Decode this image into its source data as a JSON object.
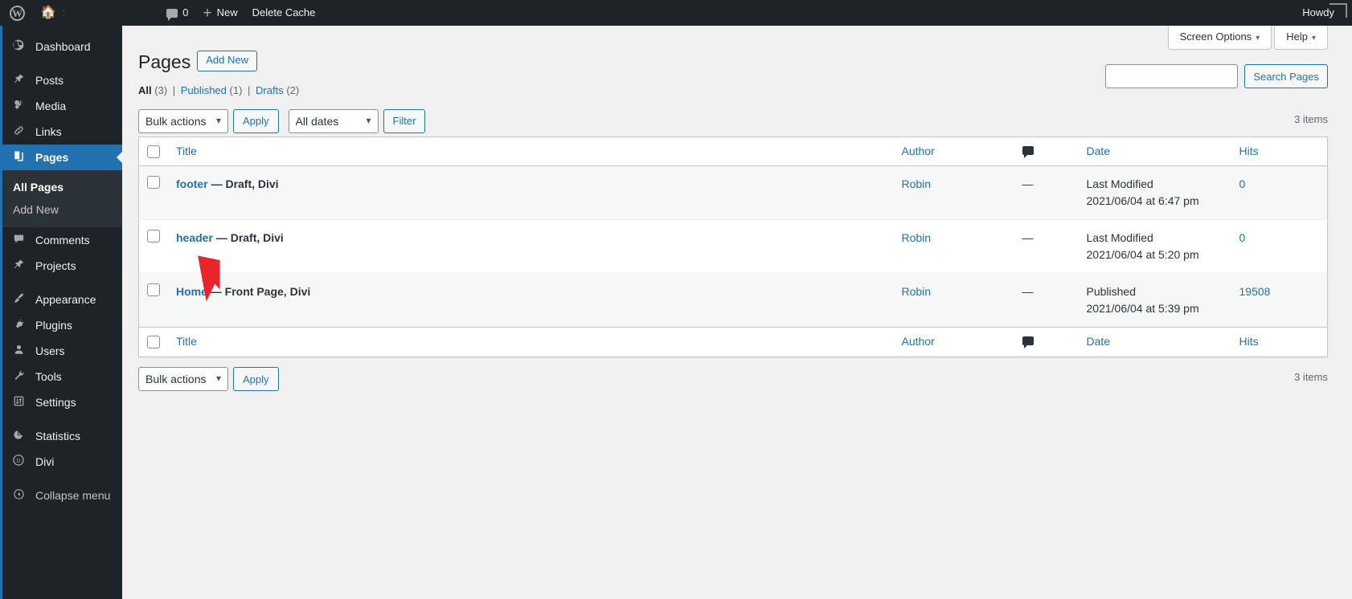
{
  "adminbar": {
    "wp_logo": "wordpress-logo",
    "site_home_icon": "home-icon",
    "site_separator": ":",
    "comments_icon": "comment-bubble-icon",
    "comments_count": "0",
    "new_plus_icon": "plus-icon",
    "new_label": "New",
    "delete_cache_label": "Delete Cache",
    "howdy_label": "Howdy"
  },
  "sidebar": {
    "items": [
      {
        "label": "Dashboard",
        "icon": "dashboard-icon",
        "glyph": "◔",
        "current": false
      },
      {
        "label": "Posts",
        "icon": "pin-icon",
        "glyph": "✒",
        "current": false
      },
      {
        "label": "Media",
        "icon": "media-icon",
        "glyph": "♪",
        "current": false
      },
      {
        "label": "Links",
        "icon": "link-icon",
        "glyph": "⚭",
        "current": false
      },
      {
        "label": "Pages",
        "icon": "page-icon",
        "glyph": "❐",
        "current": true
      },
      {
        "label": "Comments",
        "icon": "comment-icon",
        "glyph": "▬",
        "current": false
      },
      {
        "label": "Projects",
        "icon": "pin-icon",
        "glyph": "✒",
        "current": false
      },
      {
        "label": "Appearance",
        "icon": "paintbrush-icon",
        "glyph": "✐",
        "current": false
      },
      {
        "label": "Plugins",
        "icon": "plug-icon",
        "glyph": "⚡",
        "current": false
      },
      {
        "label": "Users",
        "icon": "user-icon",
        "glyph": "●",
        "current": false
      },
      {
        "label": "Tools",
        "icon": "wrench-icon",
        "glyph": "⚒",
        "current": false
      },
      {
        "label": "Settings",
        "icon": "sliders-icon",
        "glyph": "↕",
        "current": false
      },
      {
        "label": "Statistics",
        "icon": "pie-chart-icon",
        "glyph": "◔",
        "current": false
      },
      {
        "label": "Divi",
        "icon": "divi-icon",
        "glyph": "D",
        "current": false
      }
    ],
    "submenu": {
      "all_pages": "All Pages",
      "add_new": "Add New"
    },
    "collapse": {
      "label": "Collapse menu",
      "icon": "collapse-arrow-icon",
      "glyph": "◀"
    }
  },
  "screen_meta": {
    "screen_options": "Screen Options",
    "help": "Help",
    "caret": "▾"
  },
  "page": {
    "title": "Pages",
    "add_new_button": "Add New",
    "views": [
      {
        "label": "All",
        "count": "(3)",
        "current": true
      },
      {
        "label": "Published",
        "count": "(1)",
        "current": false
      },
      {
        "label": "Drafts",
        "count": "(2)",
        "current": false
      }
    ],
    "view_separator": "|"
  },
  "search": {
    "value": "",
    "placeholder": "",
    "button_label": "Search Pages"
  },
  "tablenav_top": {
    "bulk_actions_selected": "Bulk actions",
    "apply_label": "Apply",
    "dates_selected": "All dates",
    "filter_label": "Filter",
    "displaying_num": "3 items"
  },
  "tablenav_bottom": {
    "bulk_actions_selected": "Bulk actions",
    "apply_label": "Apply",
    "displaying_num": "3 items"
  },
  "table": {
    "columns": {
      "cb": "select-all-checkbox",
      "title": "Title",
      "author": "Author",
      "comments": "comment-bubble-icon",
      "date": "Date",
      "hits": "Hits"
    },
    "rows": [
      {
        "title": "footer",
        "state": "— Draft, Divi",
        "author": "Robin",
        "comments": "—",
        "date_status": "Last Modified",
        "date_value": "2021/06/04 at 6:47 pm",
        "hits": "0"
      },
      {
        "title": "header",
        "state": "— Draft, Divi",
        "author": "Robin",
        "comments": "—",
        "date_status": "Last Modified",
        "date_value": "2021/06/04 at 5:20 pm",
        "hits": "0"
      },
      {
        "title": "Home",
        "state": "— Front Page, Divi",
        "author": "Robin",
        "comments": "—",
        "date_status": "Published",
        "date_value": "2021/06/04 at 5:39 pm",
        "hits": "19508"
      }
    ]
  },
  "colors": {
    "admin_bar_bg": "#1d2327",
    "sidebar_bg": "#1d2327",
    "submenu_bg": "#2c3338",
    "accent_blue": "#2271b1",
    "link_blue": "#2271b1",
    "page_bg": "#f0f0f1",
    "cursor_red": "#e8232a"
  },
  "cursor": {
    "name": "mouse-pointer-arrow",
    "target": "Home"
  }
}
